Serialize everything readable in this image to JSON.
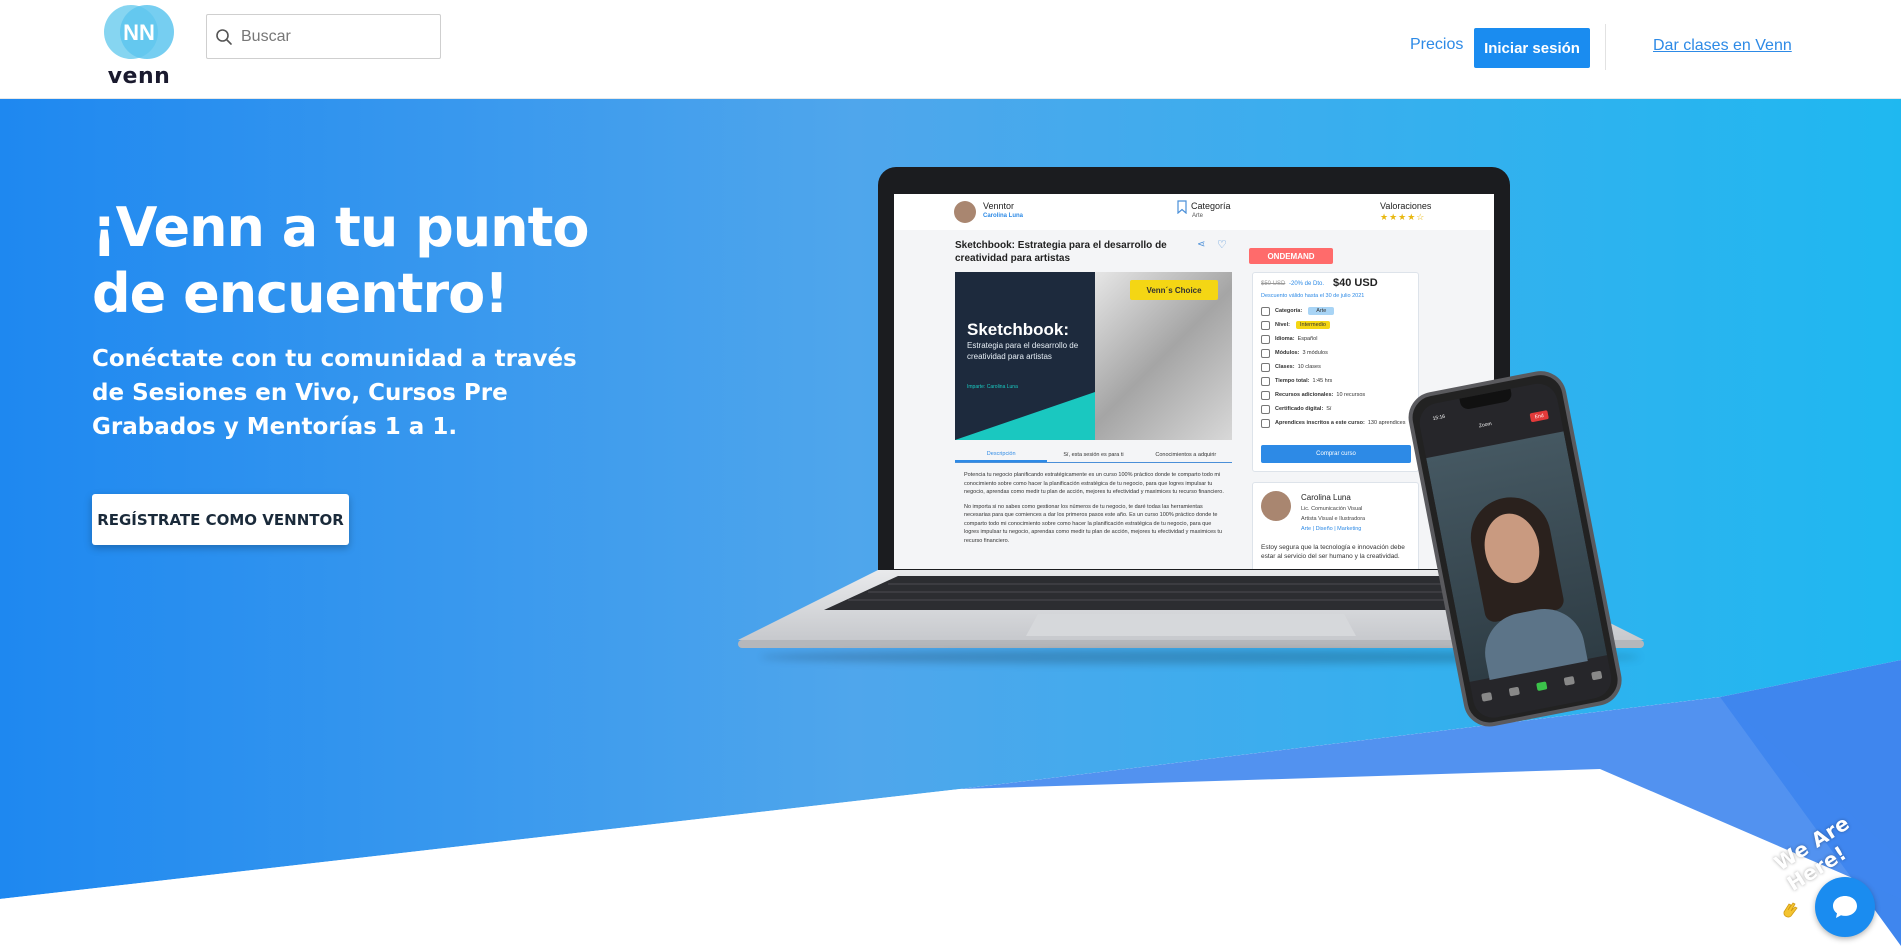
{
  "header": {
    "logo_text": "venn",
    "search_placeholder": "Buscar",
    "nav_pricing": "Precios",
    "login_button": "Iniciar sesión",
    "teach_link": "Dar clases en Venn"
  },
  "hero": {
    "title": "¡Venn a tu punto de encuentro!",
    "subtitle": "Conéctate con tu comunidad a través de Sesiones en Vivo, Cursos Pre Grabados y Mentorías 1 a 1.",
    "cta_button": "REGÍSTRATE COMO VENNTOR",
    "gradient_start": "#1e88f0",
    "gradient_end": "#1fb8f0"
  },
  "mockup": {
    "venntor_label": "Venntor",
    "venntor_name": "Carolina Luna",
    "category_label": "Categoría",
    "category_value": "Arte",
    "ratings_label": "Valoraciones",
    "stars": "★★★★☆",
    "course_title": "Sketchbook: Estrategia para el desarrollo de creatividad para artistas",
    "cover_title": "Sketchbook:",
    "cover_subtitle": "Estrategia para el desarrollo de creatividad para artistas",
    "cover_author": "Imparte: Carolina Luna",
    "badge": "Venn´s Choice",
    "tabs": [
      "Descripción",
      "Sí, esta sesión es para ti",
      "Conocimientos a adquirir"
    ],
    "description_1": "Potencia tu negocio planificando estratégicamente es un curso 100% práctico donde te comparto todo mi conocimiento sobre como hacer la planificación estratégica de tu negocio, para que logres impulsar tu negocio, aprendas como medir tu plan de acción, mejores tu efectividad y maximices tu recurso financiero.",
    "description_2": "No importa si no sabes como gestionar los números de tu negocio, te daré todas las herramientas necesarias para que comiences a dar los primeros pasos este año. Es un curso 100% práctico donde te comparto todo mi conocimiento sobre como hacer la planificación estratégica de tu negocio, para que logres impulsar tu negocio, aprendas como medir tu plan de acción, mejores tu efectividad y maximices tu recurso financiero.",
    "ondemand": "ONDEMAND",
    "old_price": "$50 USD",
    "discount": "-20% de Dto.",
    "price": "$40 USD",
    "valid_until": "Descuento válido hasta el 30 de julio 2021",
    "details": [
      {
        "label": "Categoría:",
        "value": "Arte",
        "tag": "blue"
      },
      {
        "label": "Nivel:",
        "value": "Intermedio",
        "tag": "yellow"
      },
      {
        "label": "Idioma:",
        "value": "Español",
        "tag": ""
      },
      {
        "label": "Módulos:",
        "value": "3 módulos",
        "tag": ""
      },
      {
        "label": "Clases:",
        "value": "10 clases",
        "tag": ""
      },
      {
        "label": "Tiempo total:",
        "value": "1:45 hrs",
        "tag": ""
      },
      {
        "label": "Recursos adicionales:",
        "value": "10 recursos",
        "tag": ""
      },
      {
        "label": "Certificado digital:",
        "value": "Sí",
        "tag": ""
      },
      {
        "label": "Aprendices inscritos a este curso:",
        "value": "130 aprendices",
        "tag": ""
      }
    ],
    "buy_button": "Comprar curso",
    "instructor_name": "Carolina Luna",
    "instructor_line1": "Lic. Comunicación Visual",
    "instructor_line2": "Artista Visual e Ilustradora",
    "instructor_tags": "Arte | Diseño | Marketing",
    "instructor_bio": "Estoy segura que la tecnología e innovación debe estar al servicio del ser humano y la creatividad."
  },
  "phone": {
    "time": "15:16",
    "app": "Zoom",
    "end": "End"
  },
  "chat": {
    "label": "We Are Here!"
  }
}
